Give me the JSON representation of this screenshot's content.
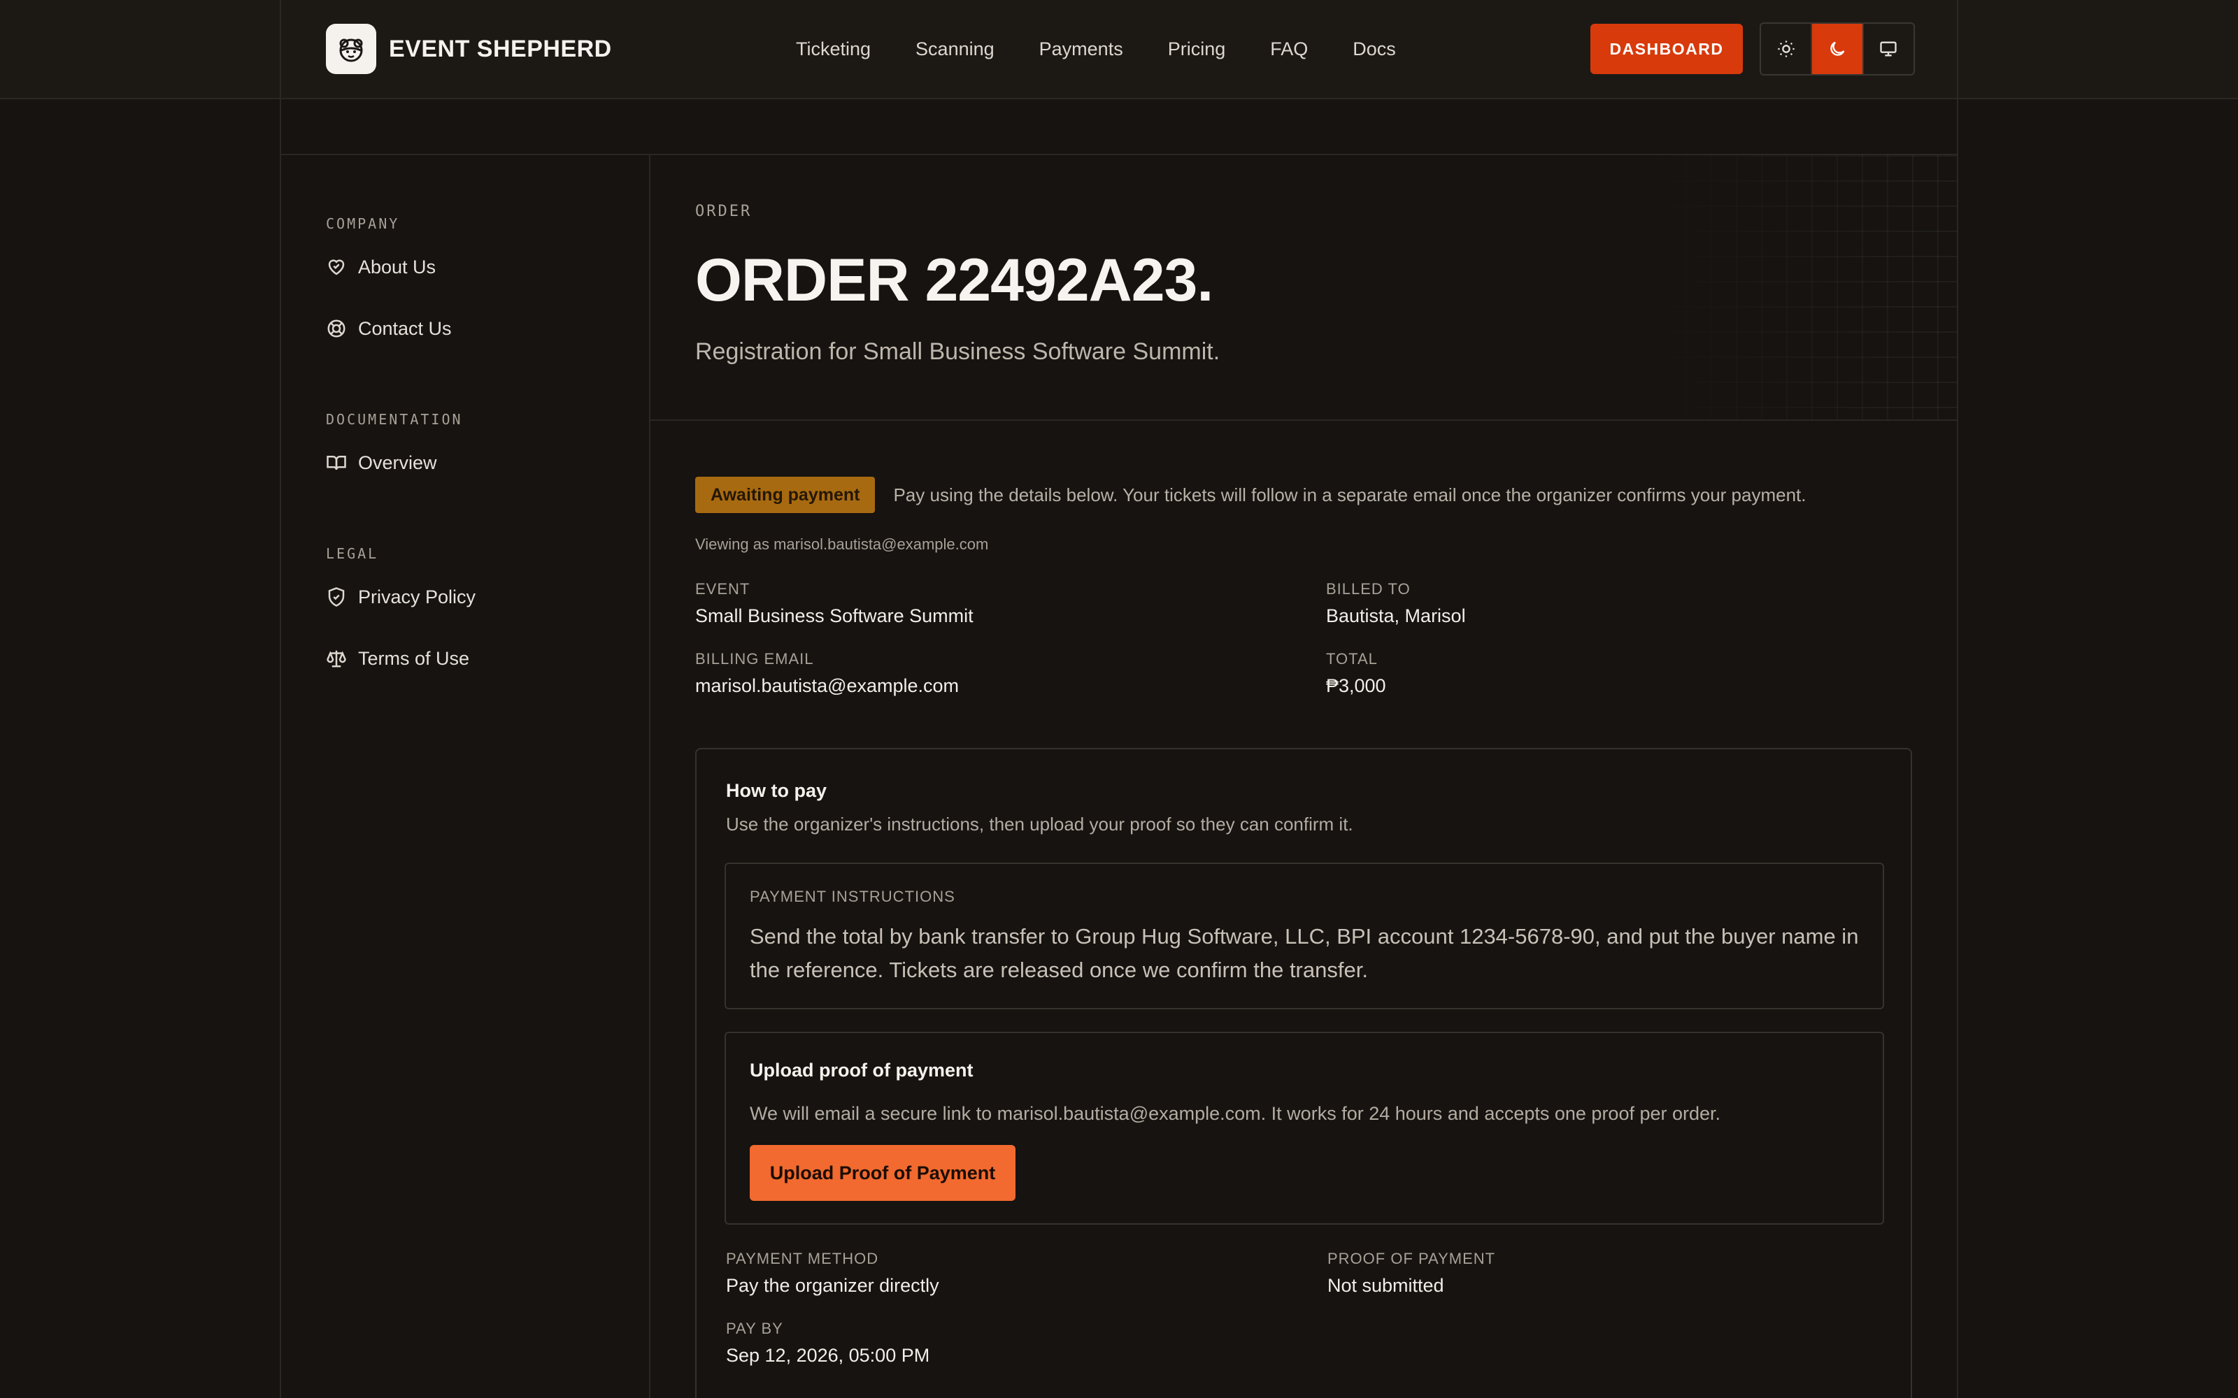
{
  "brand": {
    "name": "EVENT SHEPHERD"
  },
  "nav": {
    "items": [
      "Ticketing",
      "Scanning",
      "Payments",
      "Pricing",
      "FAQ",
      "Docs"
    ]
  },
  "header": {
    "dashboard_label": "DASHBOARD",
    "theme_active": "dark"
  },
  "sidebar": {
    "sections": [
      {
        "heading": "COMPANY",
        "items": [
          {
            "label": "About Us",
            "icon": "heart-handshake-icon"
          },
          {
            "label": "Contact Us",
            "icon": "lifebuoy-icon"
          }
        ]
      },
      {
        "heading": "DOCUMENTATION",
        "items": [
          {
            "label": "Overview",
            "icon": "book-icon"
          }
        ]
      },
      {
        "heading": "LEGAL",
        "items": [
          {
            "label": "Privacy Policy",
            "icon": "shield-icon"
          },
          {
            "label": "Terms of Use",
            "icon": "scale-icon"
          }
        ]
      }
    ]
  },
  "hero": {
    "eyebrow": "ORDER",
    "title": "ORDER 22492A23.",
    "subtitle": "Registration for Small Business Software Summit."
  },
  "status": {
    "badge": "Awaiting payment",
    "badge_color": "#a86a10",
    "message": "Pay using the details below. Your tickets will follow in a separate email once the organizer confirms your payment.",
    "viewing_as": "Viewing as marisol.bautista@example.com"
  },
  "details": {
    "event_label": "EVENT",
    "event_value": "Small Business Software Summit",
    "billed_label": "BILLED TO",
    "billed_value": "Bautista, Marisol",
    "email_label": "BILLING EMAIL",
    "email_value": "marisol.bautista@example.com",
    "total_label": "TOTAL",
    "total_value": "₱3,000"
  },
  "how_to_pay": {
    "title": "How to pay",
    "description": "Use the organizer's instructions, then upload your proof so they can confirm it.",
    "instructions_label": "PAYMENT INSTRUCTIONS",
    "instructions_text": "Send the total by bank transfer to Group Hug Software, LLC, BPI account 1234-5678-90, and put the buyer name in the reference. Tickets are released once we confirm the transfer.",
    "upload_title": "Upload proof of payment",
    "upload_desc": "We will email a secure link to marisol.bautista@example.com. It works for 24 hours and accepts one proof per order.",
    "upload_button": "Upload Proof of Payment",
    "method_label": "PAYMENT METHOD",
    "method_value": "Pay the organizer directly",
    "proof_label": "PROOF OF PAYMENT",
    "proof_value": "Not submitted",
    "payby_label": "PAY BY",
    "payby_value": "Sep 12, 2026, 05:00 PM"
  },
  "colors": {
    "accent": "#d83a0b",
    "upload_button": "#f26a2f",
    "background": "#161310"
  }
}
